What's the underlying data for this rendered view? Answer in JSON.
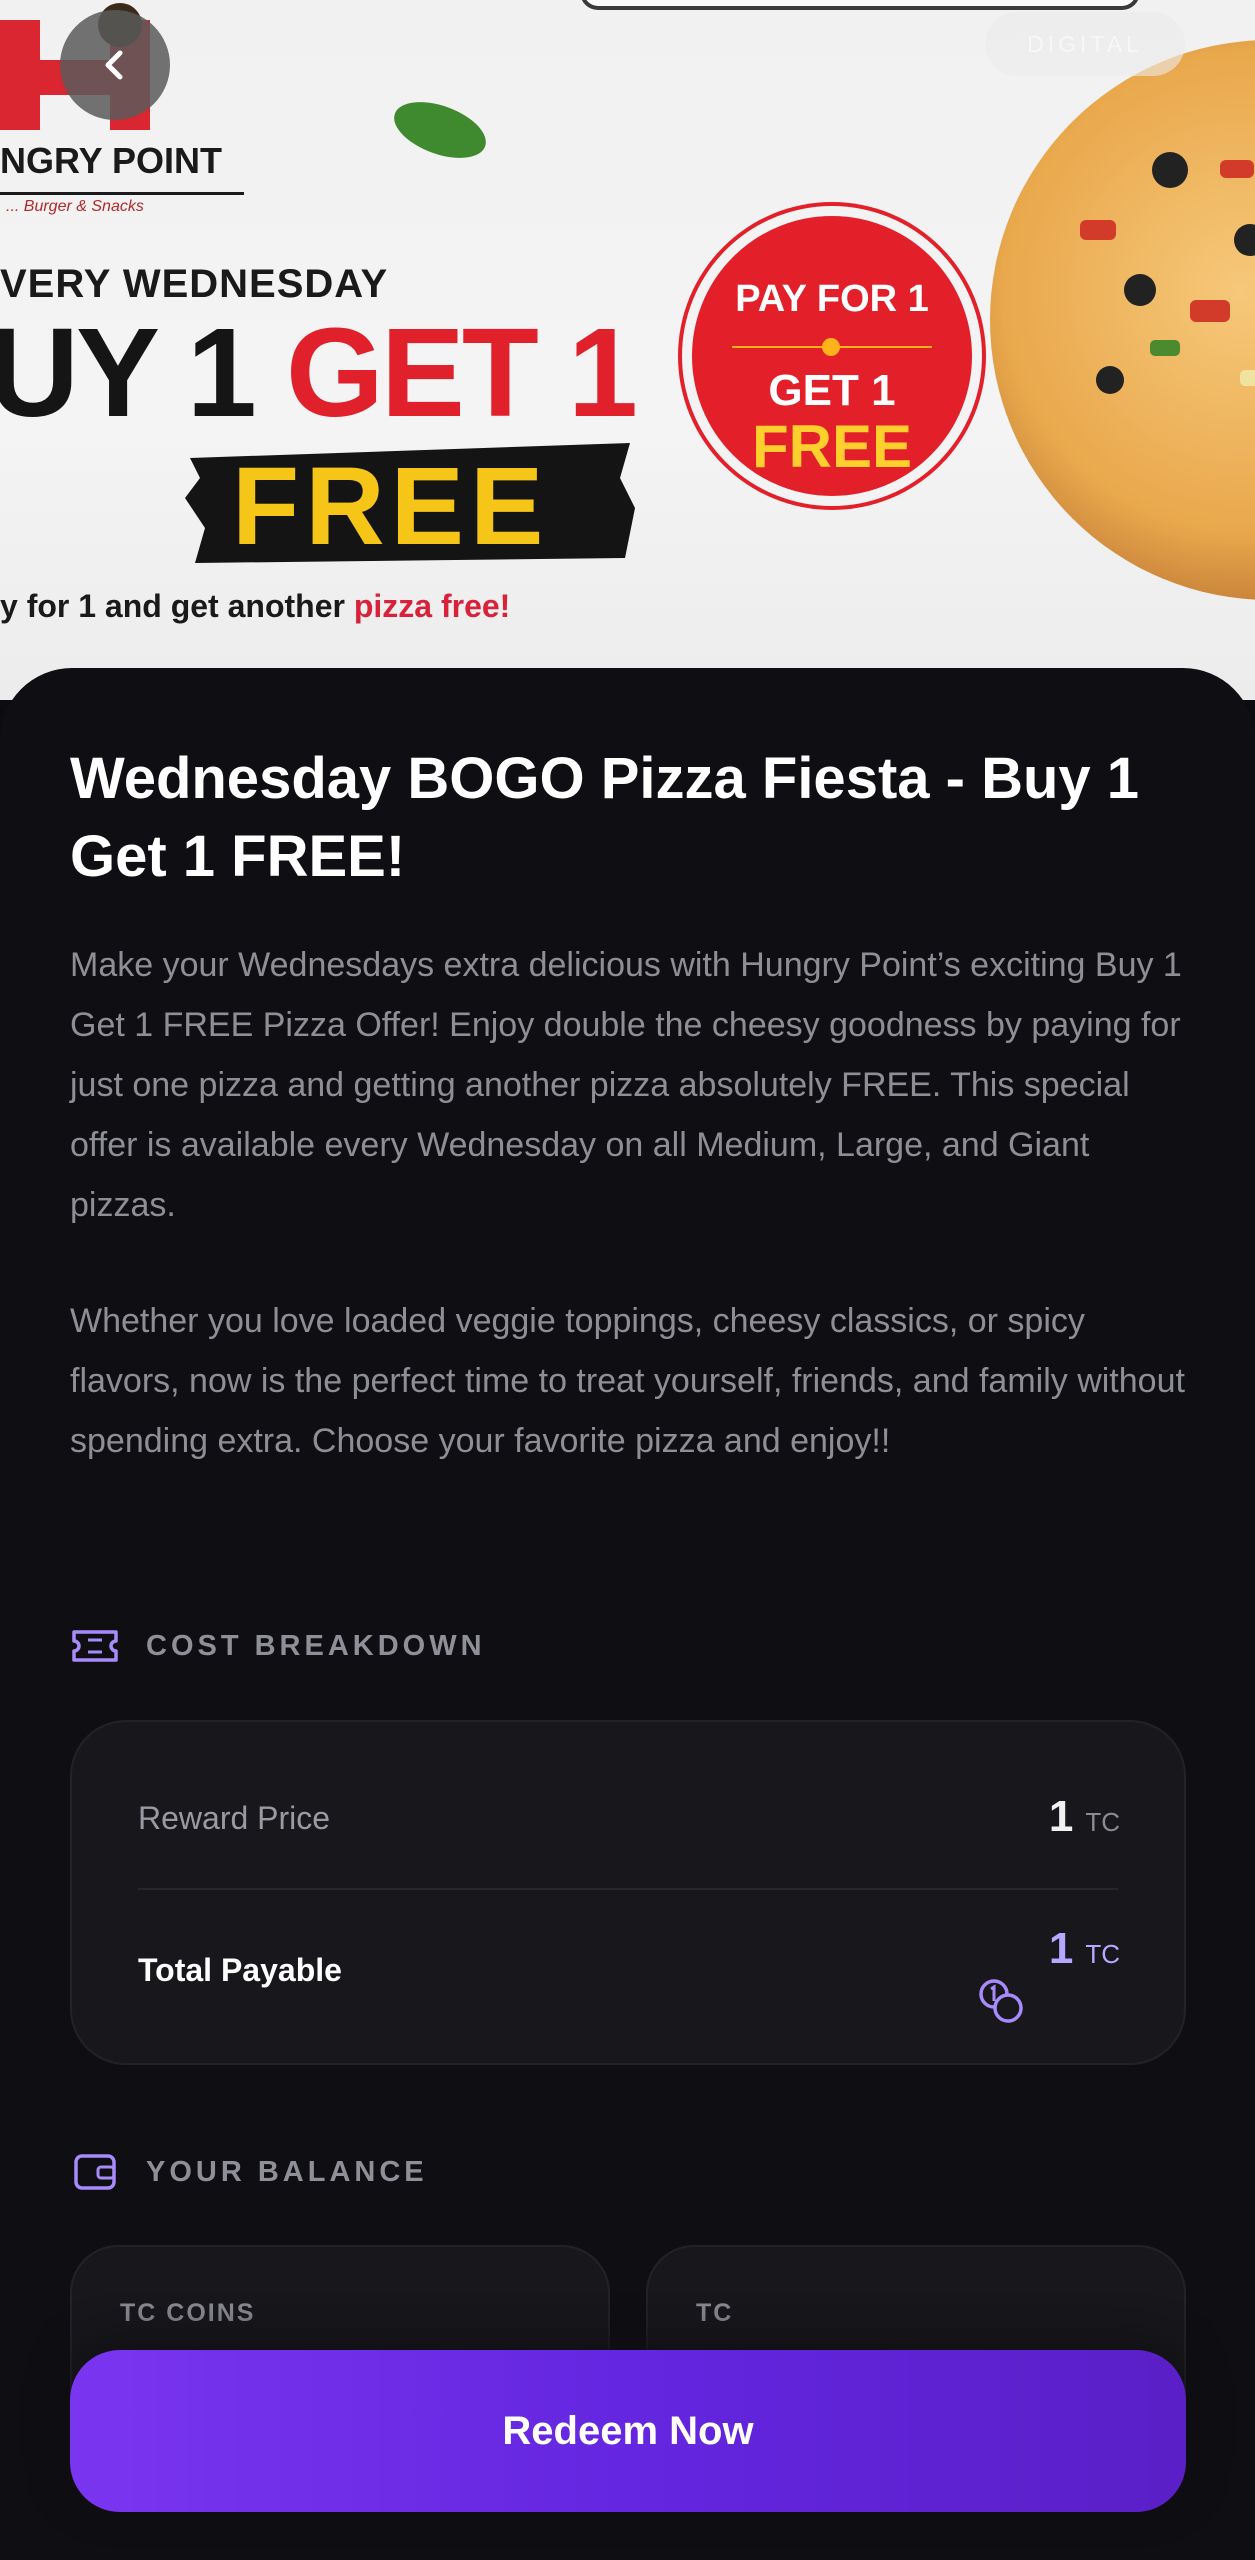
{
  "hero": {
    "digital_tag": "DIGITAL",
    "brand": "NGRY POINT",
    "brand_sub": "... Burger & Snacks",
    "every_wednesday": "VERY WEDNESDAY",
    "buy": "UY 1 ",
    "get": "GET 1",
    "free": "FREE",
    "pay_line_pre": "y for 1 and get another ",
    "pay_line_red": "pizza free!",
    "badge_line1": "PAY FOR 1",
    "badge_line2": "GET 1",
    "badge_line3": "FREE"
  },
  "offer": {
    "title": "Wednesday BOGO Pizza Fiesta - Buy 1 Get 1 FREE!",
    "description_p1": "Make your Wednesdays extra delicious with Hungry Point’s exciting Buy 1 Get 1 FREE Pizza Offer! Enjoy double the cheesy goodness by paying for just one pizza and getting another pizza absolutely FREE. This special offer is available every Wednesday on all Medium, Large, and Giant pizzas.",
    "description_p2": "Whether you love loaded veggie toppings, cheesy classics, or spicy flavors, now is the perfect time to treat yourself, friends, and family without spending extra. Choose your favorite pizza and enjoy!!"
  },
  "cost_breakdown": {
    "heading": "COST BREAKDOWN",
    "reward_price_label": "Reward Price",
    "reward_price_value": "1",
    "reward_price_unit": "TC",
    "total_label": "Total Payable",
    "total_value": "1",
    "total_unit": "TC"
  },
  "balance": {
    "heading": "YOUR BALANCE",
    "tc_coins_label": "TC COINS",
    "tc_label": "TC"
  },
  "actions": {
    "redeem_label": "Redeem Now"
  },
  "colors": {
    "accent": "#7a35f0",
    "accent_text": "#b6a7ff",
    "background": "#0f0f13",
    "card": "#17171c"
  }
}
